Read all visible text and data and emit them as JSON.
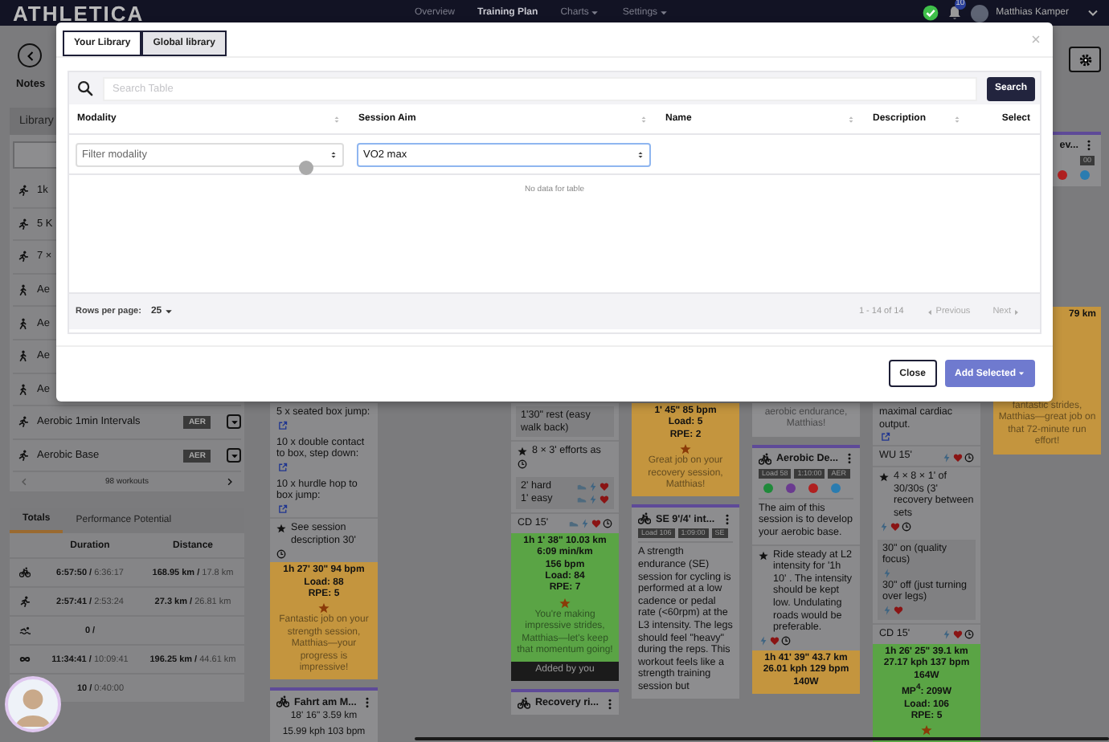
{
  "nav": {
    "logo": "ATHLETICA",
    "links": [
      {
        "label": "Overview",
        "selected": false,
        "dropdown": false
      },
      {
        "label": "Training Plan",
        "selected": true,
        "dropdown": false
      },
      {
        "label": "Charts",
        "selected": false,
        "dropdown": true
      },
      {
        "label": "Settings",
        "selected": false,
        "dropdown": true
      }
    ],
    "badge": "10",
    "user": "Matthias Kamper"
  },
  "sidebar": {
    "notes": "Notes",
    "tab": "Library",
    "workouts": [
      {
        "name": "1k",
        "kind": "run"
      },
      {
        "name": "5 K",
        "kind": "run"
      },
      {
        "name": "7 ×",
        "kind": "run"
      },
      {
        "name": "Ae",
        "kind": "hike"
      },
      {
        "name": "Ae",
        "kind": "hike"
      },
      {
        "name": "Ae",
        "kind": "hike"
      },
      {
        "name": "Ae",
        "kind": "hike"
      },
      {
        "name": "Aerobic 1min Intervals",
        "kind": "run",
        "tag": "AER"
      },
      {
        "name": "Aerobic Base",
        "kind": "run",
        "tag": "AER"
      }
    ],
    "pager": "98 workouts",
    "totals_tabs": [
      {
        "label": "Totals",
        "selected": true
      },
      {
        "label": "Performance Potential",
        "selected": false
      }
    ],
    "columns": [
      "Duration",
      "Distance"
    ],
    "rows": [
      {
        "kind": "bike",
        "duration": "6:57:50 /",
        "duration_prev": "6:36:17",
        "distance": "168.95 km /",
        "distance_prev": "17.8 km"
      },
      {
        "kind": "run",
        "duration": "2:57:41 /",
        "duration_prev": "2:53:24",
        "distance": "27.3 km /",
        "distance_prev": "26.81 km"
      },
      {
        "kind": "swim",
        "duration": "0 /"
      },
      {
        "kind": "infinity",
        "duration": "11:34:41 /",
        "duration_prev": "10:09:41",
        "distance": "196.25 km /",
        "distance_prev": "44.61 km"
      },
      {
        "duration": "10 /",
        "duration_prev": "0:40:00"
      }
    ]
  },
  "board": {
    "columns": [
      {
        "items": [
          {
            "kind": "note",
            "text": "5 x seated box jump:",
            "link": true
          },
          {
            "kind": "note",
            "text": "10 x double contact to box, step down:",
            "link": true
          },
          {
            "kind": "note",
            "text": "10 x hurdle hop to box jump:",
            "link": true
          },
          {
            "kind": "step",
            "star": true,
            "text": "See session description 30'",
            "icons": [
              {
                "kind": "clock"
              }
            ]
          },
          {
            "kind": "result",
            "color": "#c4953e",
            "lines": [
              "1h 27' 30\"  94 bpm",
              "Load: 88",
              "RPE: 5"
            ],
            "starred": true,
            "message": "Fantastic job on your strength session, Matthias—your progress is impressive!"
          },
          {
            "kind": "card",
            "activity": {
              "kind": "bike"
            },
            "title": "Fahrt am M...",
            "lines": [
              "18' 16\"  3.59 km",
              "15.99 kph  103 bpm"
            ]
          }
        ]
      },
      {},
      {
        "items": [
          {
            "kind": "block",
            "lines": [
              {
                "text": "1'30\" rest (easy walk back)"
              }
            ]
          },
          {
            "kind": "step",
            "star": true,
            "text": "8 × 3' efforts as",
            "icons": [
              {
                "kind": "clock"
              }
            ]
          },
          {
            "kind": "block",
            "lines": [
              {
                "text": "2' hard",
                "icons": [
                  {
                    "kind": "shoe"
                  },
                  {
                    "kind": "bolt"
                  },
                  {
                    "kind": "heart"
                  }
                ]
              },
              {
                "text": "1' easy",
                "icons": [
                  {
                    "kind": "shoe"
                  },
                  {
                    "kind": "bolt"
                  },
                  {
                    "kind": "heart"
                  }
                ]
              }
            ]
          },
          {
            "kind": "step",
            "text": "CD 15'",
            "icons": [
              {
                "kind": "shoe"
              },
              {
                "kind": "bolt"
              },
              {
                "kind": "heart"
              },
              {
                "kind": "clock"
              }
            ]
          },
          {
            "kind": "result",
            "color": "#5aa445",
            "lines": [
              "1h 1' 38\"  10.03 km",
              "6:09 min/km",
              "156 bpm",
              "Load: 84",
              "RPE: 7"
            ],
            "starred": true,
            "message": "You're making impressive strides, Matthias—let's keep that momentum going!"
          },
          {
            "kind": "added",
            "text": "Added by you"
          },
          {
            "kind": "card",
            "activity": {
              "kind": "bike"
            },
            "title": "Recovery ri..."
          }
        ]
      },
      {
        "items": [
          {
            "kind": "result",
            "color": "#c4953e",
            "lines": [
              "1' 45\"  85 bpm",
              "Load: 5",
              "RPE: 2"
            ],
            "starred": true,
            "message": "Great job on your recovery session, Matthias!"
          },
          {
            "kind": "card",
            "activity": {
              "kind": "bike"
            },
            "title": "SE 9'/4' int...",
            "tags": [
              "Load 106",
              "1:09:00",
              "SE"
            ],
            "description": "A strength endurance (SE) session for cycling is performed at a low cadence or pedal rate (<60rpm) at the L3 intensity. The legs should feel \"heavy\" during the reps. This workout feels like a strength training session but"
          }
        ]
      },
      {
        "items": [
          {
            "kind": "result",
            "color": "#8e8e90",
            "message": "aerobic endurance, Matthias!"
          },
          {
            "kind": "card",
            "activity": {
              "kind": "bike"
            },
            "title": "Aerobic De...",
            "tags": [
              "Load 58",
              "1:10:00",
              "AER"
            ],
            "apps": [
              {
                "color": "#1f8a3a"
              },
              {
                "color": "#6a3a90"
              },
              {
                "color": "#b02020"
              },
              {
                "color": "#2a7cb0"
              }
            ],
            "description": "The aim of this session is to develop your aerobic base."
          },
          {
            "kind": "step",
            "star": true,
            "text": "Ride steady at L2 intensity for '1h 10' . The intensity should be kept low. Undulating roads would be preferable.",
            "icons": [
              {
                "kind": "bolt"
              },
              {
                "kind": "heart"
              },
              {
                "kind": "clock"
              }
            ]
          },
          {
            "kind": "result",
            "color": "#c4953e",
            "lines": [
              "1h 41' 39\"  43.7 km",
              "26.01 kph  129 bpm",
              "140W"
            ]
          }
        ]
      },
      {
        "items": [
          {
            "kind": "note",
            "text": "maximal cardiac output.",
            "link": true
          },
          {
            "kind": "step",
            "text": "WU 15'",
            "icons": [
              {
                "kind": "bolt"
              },
              {
                "kind": "heart"
              },
              {
                "kind": "clock"
              }
            ]
          },
          {
            "kind": "step",
            "star": true,
            "text": "4 × 8 × 1' of 30/30s (3' recovery between sets",
            "icons": [
              {
                "kind": "bolt"
              },
              {
                "kind": "heart"
              },
              {
                "kind": "clock"
              }
            ]
          },
          {
            "kind": "block",
            "lines": [
              {
                "text": "30\" on (quality focus)",
                "icons": [
                  {
                    "kind": "bolt"
                  }
                ]
              },
              {
                "text": "30\" off (just turning over legs)",
                "icons": [
                  {
                    "kind": "bolt"
                  },
                  {
                    "kind": "heart"
                  }
                ]
              }
            ]
          },
          {
            "kind": "step",
            "text": "CD 15'",
            "icons": [
              {
                "kind": "bolt"
              },
              {
                "kind": "heart"
              },
              {
                "kind": "clock"
              }
            ]
          },
          {
            "kind": "result",
            "color": "#5aa445",
            "lines": [
              "1h 26' 25\"  39.1 km",
              "27.17 kph  137 bpm",
              "164W",
              "MP$^{4}$: 209W",
              "Load: 106",
              "RPE: 5"
            ],
            "starred": true
          }
        ]
      },
      {
        "items": [
          {
            "kind": "card",
            "title": "ev...",
            "tags": [
              "00"
            ],
            "apps": [
              {
                "color": "#b02020"
              },
              {
                "color": "#2a7cb0"
              }
            ]
          },
          {
            "kind": "result",
            "color": "#c4953e",
            "lines": [
              "79 km"
            ],
            "message": "fantastic strides, Matthias—great job on that 72-minute run effort!"
          }
        ]
      }
    ]
  },
  "modal": {
    "tabs": [
      {
        "label": "Your Library",
        "selected": true
      },
      {
        "label": "Global library",
        "selected": false
      }
    ],
    "search": {
      "placeholder": "Search Table"
    },
    "search_button": "Search",
    "columns": [
      {
        "label": "Modality",
        "sortable": true
      },
      {
        "label": "Session Aim",
        "sortable": true
      },
      {
        "label": "Name",
        "sortable": true
      },
      {
        "label": "Description",
        "sortable": true
      },
      {
        "label": "Select",
        "sortable": false
      }
    ],
    "filters": [
      {
        "placeholder": "Filter modality",
        "focused": false
      },
      {
        "value": "VO2 max",
        "focused": true
      }
    ],
    "empty": "No data for table",
    "rows_per_page_label": "Rows per page:",
    "rows_per_page": "25",
    "range": "1 - 14 of 14",
    "previous": {
      "label": "Previous",
      "disabled": true
    },
    "next": {
      "label": "Next",
      "disabled": true
    },
    "buttons": [
      {
        "label": "Close",
        "kind": "secondary"
      },
      {
        "label": "Add Selected",
        "kind": "primary",
        "dropdown": true
      }
    ]
  }
}
